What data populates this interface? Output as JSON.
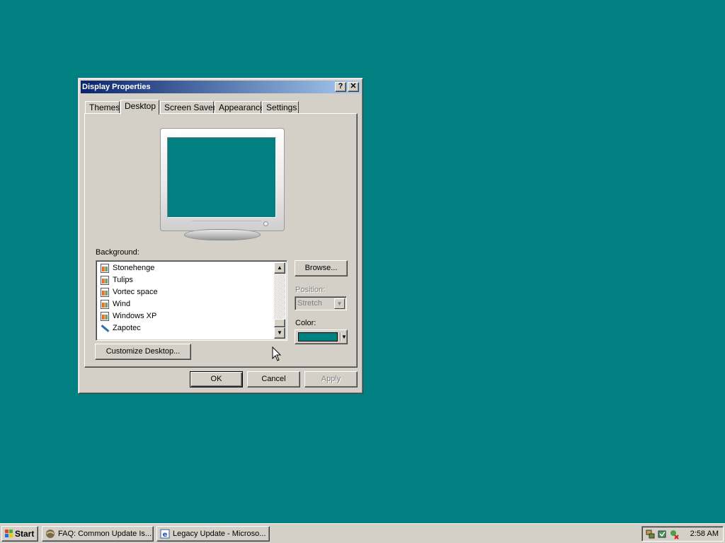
{
  "window": {
    "title": "Display Properties",
    "help_label": "?",
    "close_label": "✕"
  },
  "tabs": [
    {
      "label": "Themes",
      "active": false
    },
    {
      "label": "Desktop",
      "active": true
    },
    {
      "label": "Screen Saver",
      "active": false
    },
    {
      "label": "Appearance",
      "active": false
    },
    {
      "label": "Settings",
      "active": false
    }
  ],
  "desktop_tab": {
    "background_label": "Background:",
    "background_items": [
      {
        "label": "Stonehenge",
        "icon": "image-file-icon"
      },
      {
        "label": "Tulips",
        "icon": "image-file-icon"
      },
      {
        "label": "Vortec space",
        "icon": "image-file-icon"
      },
      {
        "label": "Wind",
        "icon": "image-file-icon"
      },
      {
        "label": "Windows XP",
        "icon": "image-file-icon"
      },
      {
        "label": "Zapotec",
        "icon": "pen-file-icon"
      }
    ],
    "browse_label": "Browse...",
    "position_label": "Position:",
    "position_value": "Stretch",
    "color_label": "Color:",
    "color_value": "#008080",
    "customize_label": "Customize Desktop..."
  },
  "dialog_buttons": {
    "ok": "OK",
    "cancel": "Cancel",
    "apply": "Apply"
  },
  "taskbar": {
    "start_label": "Start",
    "tasks": [
      {
        "label": "FAQ: Common Update Is...",
        "icon": "browser-icon"
      },
      {
        "label": "Legacy Update - Microso...",
        "icon": "ie-icon"
      }
    ],
    "clock": "2:58 AM"
  },
  "colors": {
    "desktop": "#008080",
    "face": "#d4d0c8",
    "title_start": "#0a246a",
    "title_end": "#a6caf0"
  }
}
